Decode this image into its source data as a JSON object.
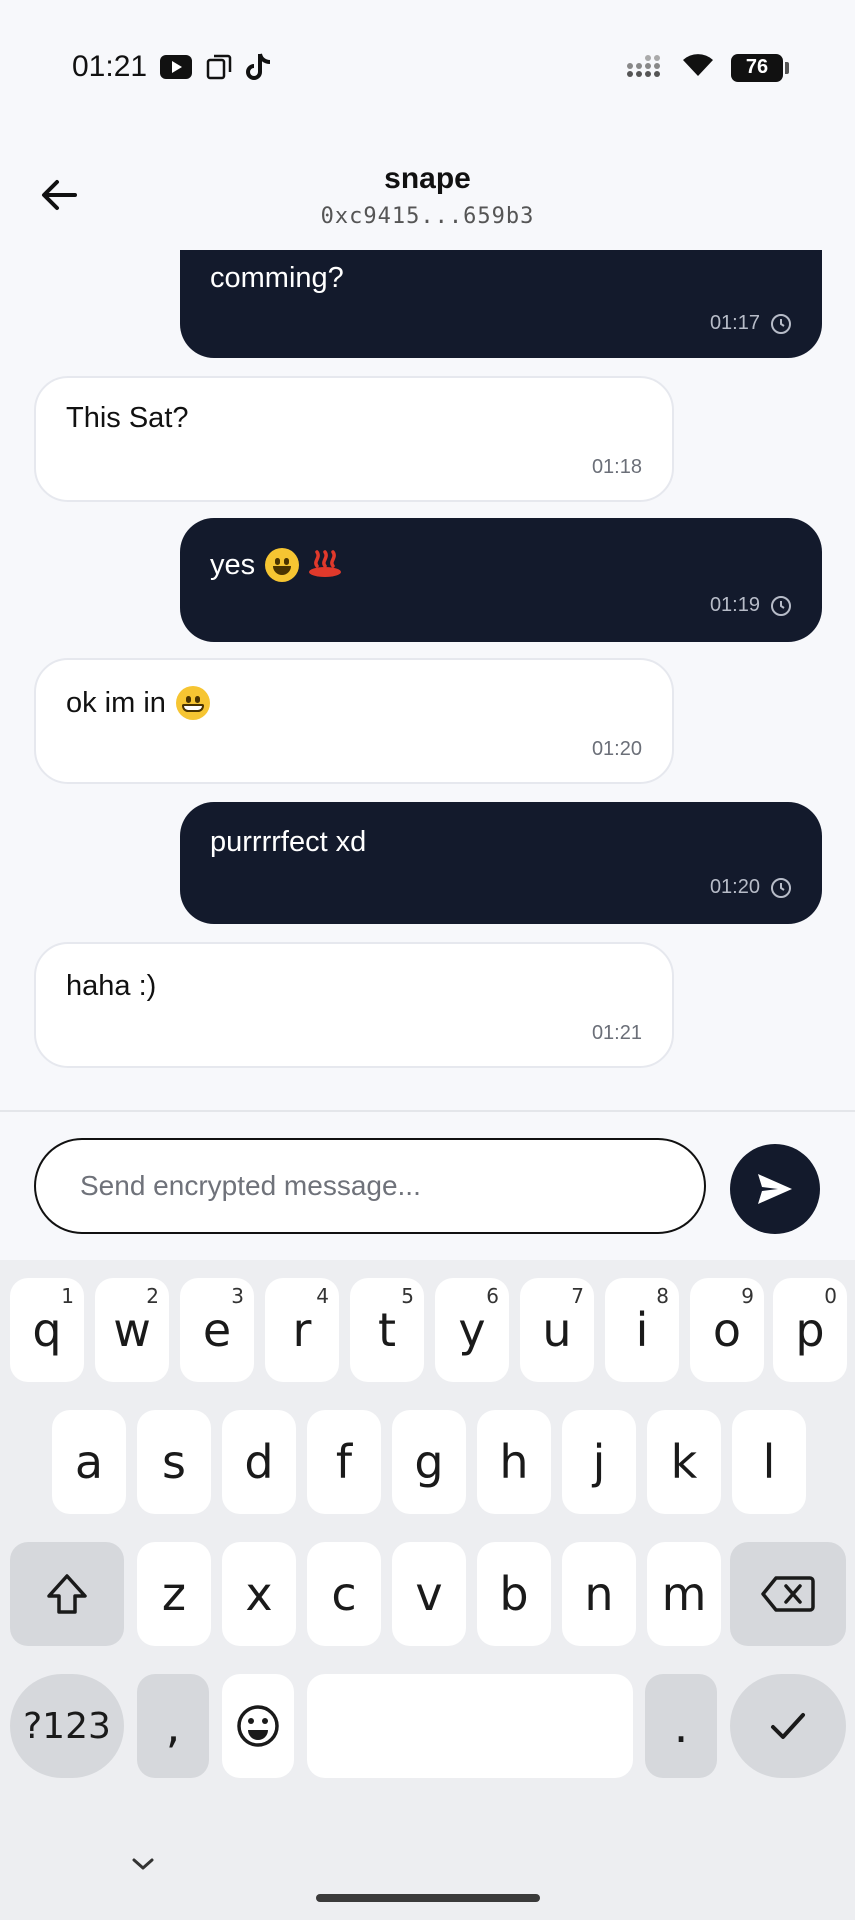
{
  "status_bar": {
    "time": "01:21",
    "battery": "76",
    "left_icons": [
      "youtube-icon",
      "copy-icon",
      "tiktok-icon"
    ],
    "right_icons": [
      "signal-icon",
      "wifi-icon",
      "battery-icon"
    ]
  },
  "header": {
    "name": "snape",
    "address": "0xc9415...659b3"
  },
  "messages": [
    {
      "direction": "out",
      "text": "comming?",
      "time": "01:17"
    },
    {
      "direction": "in",
      "text": "This Sat?",
      "time": "01:18"
    },
    {
      "direction": "out",
      "text": "yes",
      "time": "01:19"
    },
    {
      "direction": "in",
      "text": "ok im in",
      "time": "01:20"
    },
    {
      "direction": "out",
      "text": "purrrrfect xd",
      "time": "01:20"
    },
    {
      "direction": "in",
      "text": "haha :)",
      "time": "01:21"
    }
  ],
  "input": {
    "placeholder": "Send encrypted message...",
    "value": ""
  },
  "keyboard": {
    "row1": [
      {
        "key": "q",
        "hint": "1"
      },
      {
        "key": "w",
        "hint": "2"
      },
      {
        "key": "e",
        "hint": "3"
      },
      {
        "key": "r",
        "hint": "4"
      },
      {
        "key": "t",
        "hint": "5"
      },
      {
        "key": "y",
        "hint": "6"
      },
      {
        "key": "u",
        "hint": "7"
      },
      {
        "key": "i",
        "hint": "8"
      },
      {
        "key": "o",
        "hint": "9"
      },
      {
        "key": "p",
        "hint": "0"
      }
    ],
    "row2": [
      "a",
      "s",
      "d",
      "f",
      "g",
      "h",
      "j",
      "k",
      "l"
    ],
    "row3": [
      "z",
      "x",
      "c",
      "v",
      "b",
      "n",
      "m"
    ],
    "symbols_label": "?123",
    "comma_label": ",",
    "period_label": "."
  },
  "colors": {
    "outgoing_bubble": "#131a2c",
    "incoming_bubble": "#ffffff",
    "background": "#f7f8fb"
  }
}
